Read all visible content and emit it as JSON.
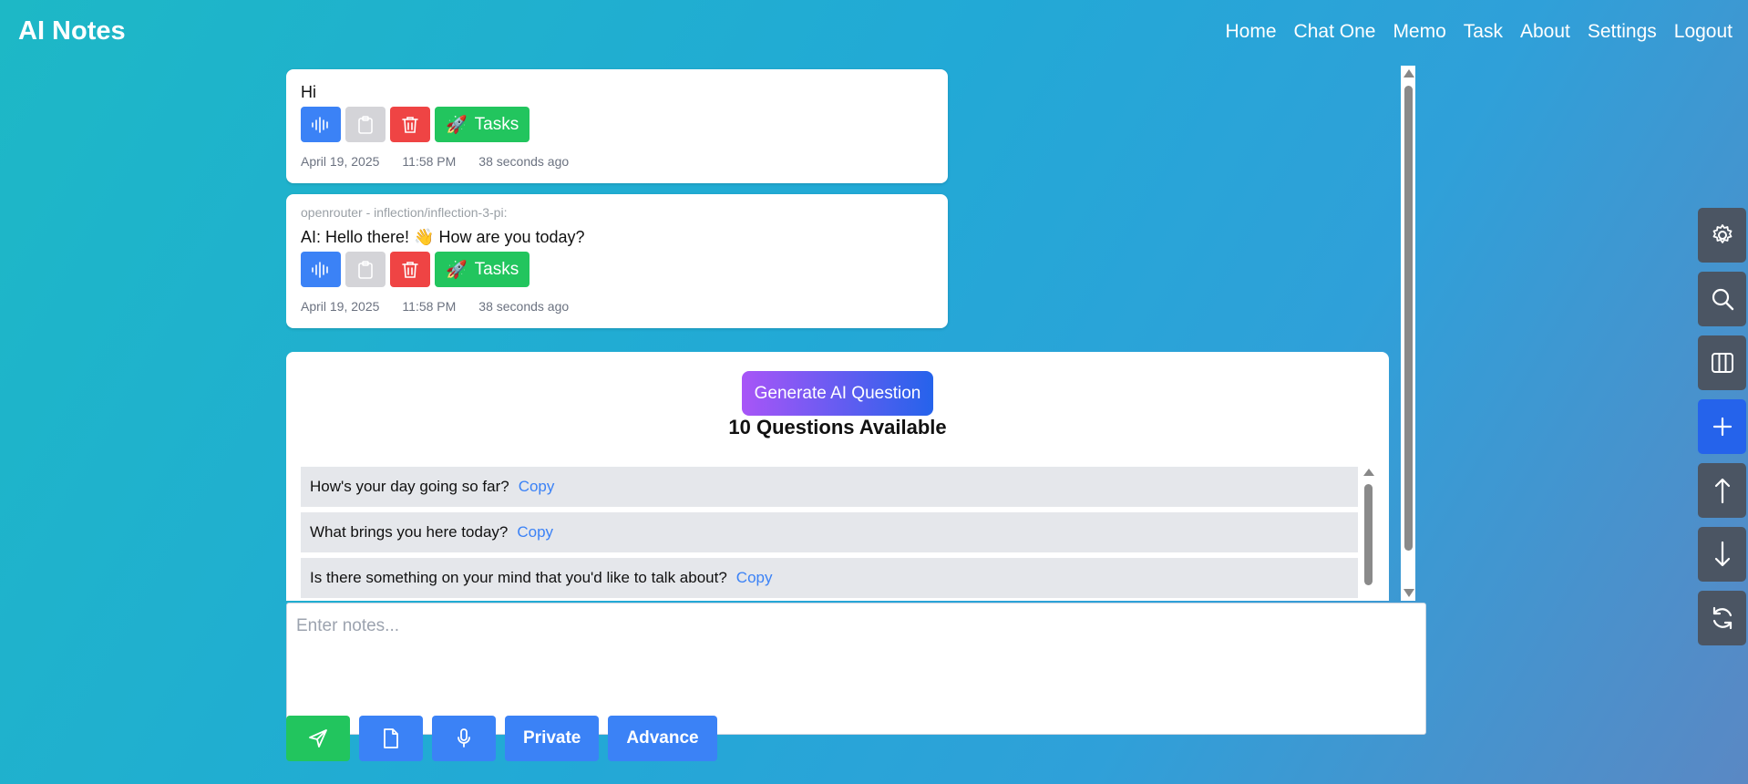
{
  "app": {
    "title": "AI Notes"
  },
  "nav": {
    "items": [
      "Home",
      "Chat One",
      "Memo",
      "Task",
      "About",
      "Settings",
      "Logout"
    ]
  },
  "messages": [
    {
      "model": "",
      "text": "Hi",
      "date": "April 19, 2025",
      "time": "11:58 PM",
      "ago": "38 seconds ago",
      "tasks_label": "Tasks"
    },
    {
      "model": "openrouter - inflection/inflection-3-pi:",
      "text": "AI:  Hello there! 👋 How are you today?",
      "date": "April 19, 2025",
      "time": "11:58 PM",
      "ago": "38 seconds ago",
      "tasks_label": "Tasks"
    }
  ],
  "questions": {
    "generate_label": "Generate AI Question",
    "count_label": "10 Questions Available",
    "copy_label": "Copy",
    "items": [
      "How's your day going so far?",
      "What brings you here today?",
      "Is there something on your mind that you'd like to talk about?"
    ]
  },
  "notes": {
    "placeholder": "Enter notes..."
  },
  "bottom": {
    "private_label": "Private",
    "advance_label": "Advance"
  },
  "side_buttons": [
    "gear-icon",
    "search-icon",
    "columns-icon",
    "plus-icon",
    "arrow-up-icon",
    "arrow-down-icon",
    "refresh-icon"
  ],
  "colors": {
    "primary": "#3b82f6",
    "success": "#22c55e",
    "danger": "#ef4444",
    "side_dark": "#4b5563",
    "side_active": "#2563eb"
  }
}
